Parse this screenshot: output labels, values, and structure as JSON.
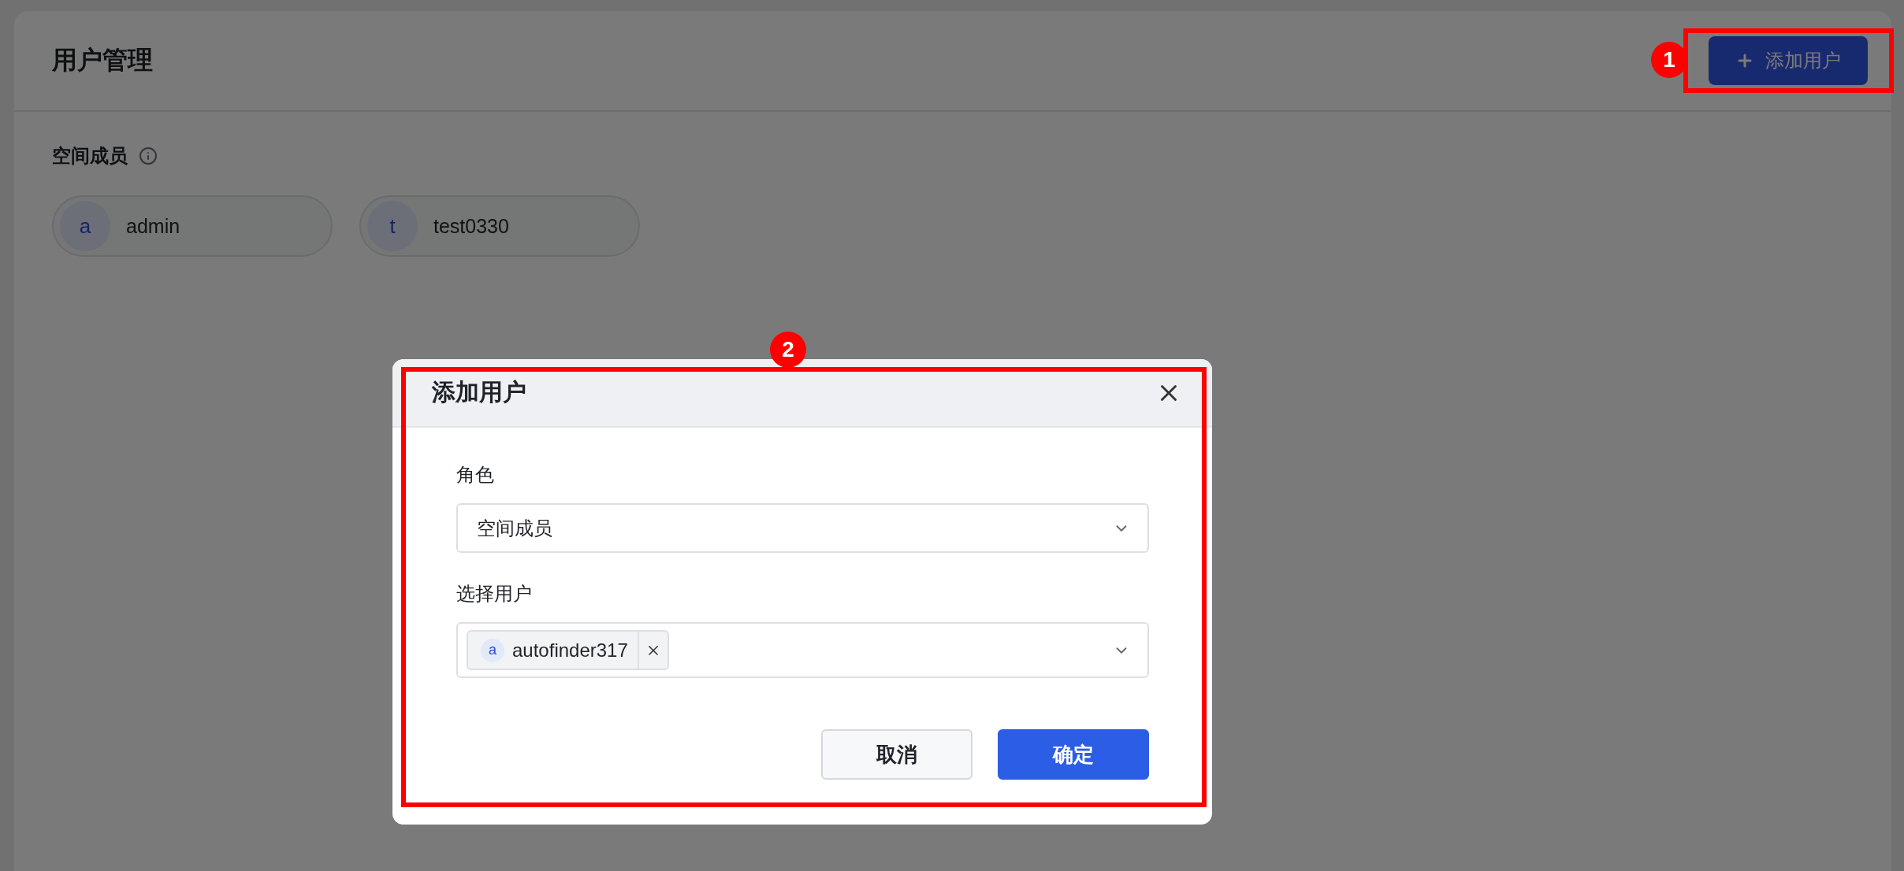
{
  "page": {
    "title": "用户管理",
    "add_button": {
      "label": "添加用户"
    },
    "section": {
      "title": "空间成员"
    },
    "members": [
      {
        "initial": "a",
        "name": "admin"
      },
      {
        "initial": "t",
        "name": "test0330"
      }
    ]
  },
  "dialog": {
    "title": "添加用户",
    "fields": [
      {
        "kind": "select",
        "label": "角色",
        "value": "空间成员"
      },
      {
        "kind": "multiselect",
        "label": "选择用户",
        "tags": [
          {
            "initial": "a",
            "name": "autofinder317"
          }
        ]
      }
    ],
    "buttons": [
      {
        "label": "取消",
        "primary": false
      },
      {
        "label": "确定",
        "primary": true
      }
    ]
  },
  "annotations": [
    {
      "label": "1"
    },
    {
      "label": "2"
    }
  ]
}
